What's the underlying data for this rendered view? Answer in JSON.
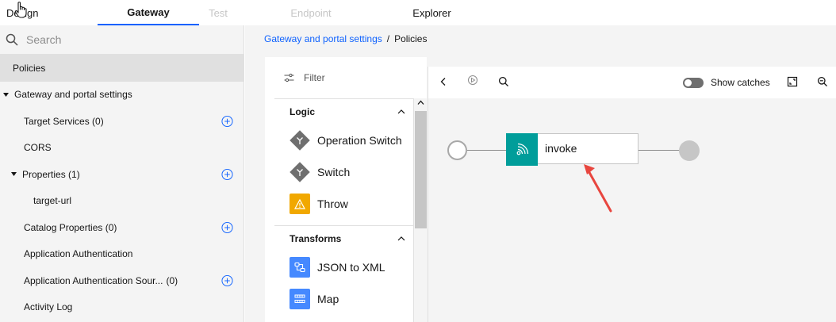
{
  "tabs": [
    {
      "label": "Design"
    },
    {
      "label": "Gateway"
    },
    {
      "label": "Test"
    },
    {
      "label": "Endpoint"
    },
    {
      "label": "Explorer"
    }
  ],
  "sidebar": {
    "search_placeholder": "Search",
    "items": [
      {
        "label": "Policies"
      },
      {
        "label": "Gateway and portal settings"
      },
      {
        "label": "Target Services (0)"
      },
      {
        "label": "CORS"
      },
      {
        "label": "Properties (1)"
      },
      {
        "label": "target-url"
      },
      {
        "label": "Catalog Properties (0)"
      },
      {
        "label": "Application Authentication"
      },
      {
        "label": "Application Authentication Sour...",
        "count": "(0)"
      },
      {
        "label": "Activity Log"
      }
    ]
  },
  "breadcrumb": {
    "link": "Gateway and portal settings",
    "separator": "/",
    "current": "Policies"
  },
  "palette": {
    "filter_label": "Filter",
    "logic": {
      "title": "Logic",
      "items": [
        {
          "label": "Operation Switch",
          "icon": "operation-switch-icon"
        },
        {
          "label": "Switch",
          "icon": "switch-icon"
        },
        {
          "label": "Throw",
          "icon": "warning-icon"
        }
      ]
    },
    "transforms": {
      "title": "Transforms",
      "items": [
        {
          "label": "JSON to XML",
          "icon": "json-to-xml-icon"
        },
        {
          "label": "Map",
          "icon": "map-icon"
        }
      ]
    }
  },
  "canvas": {
    "show_catches_label": "Show catches",
    "invoke_label": "invoke"
  },
  "colors": {
    "accent": "#0f62fe",
    "invoke": "#009d9a",
    "throw": "#f1a800",
    "transform": "#4589ff",
    "arrow": "#e8463f"
  }
}
